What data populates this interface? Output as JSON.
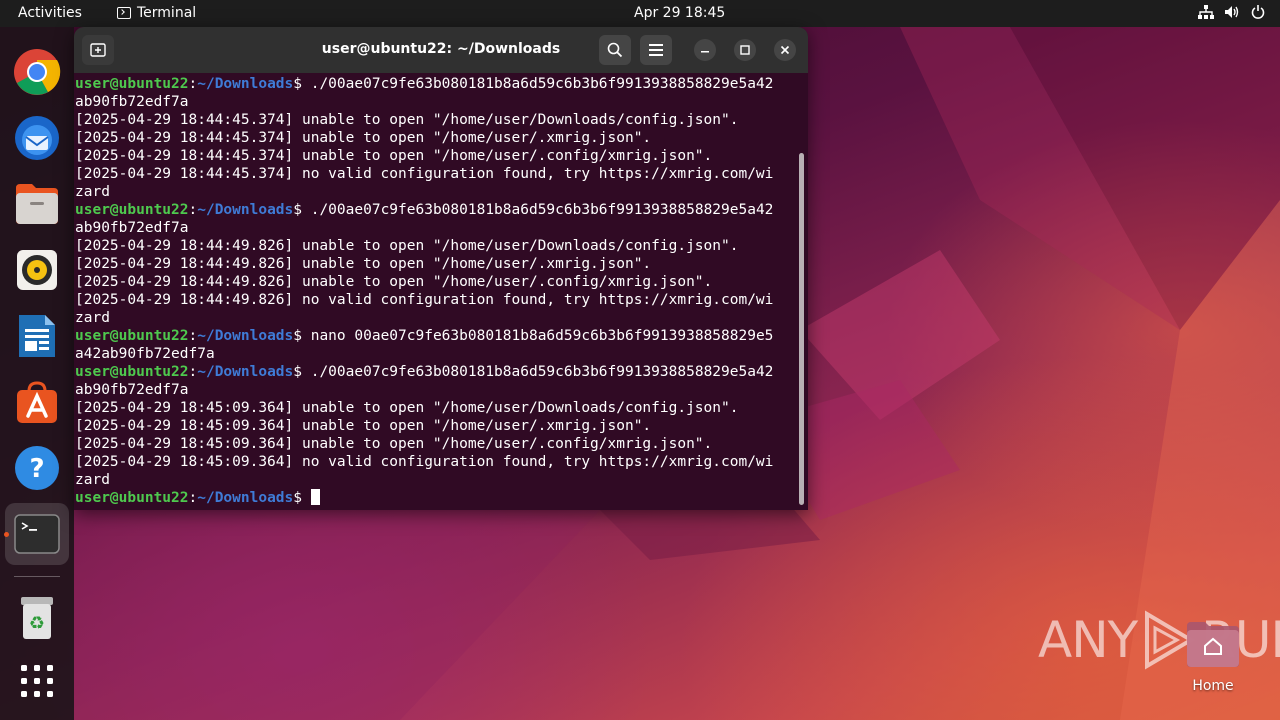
{
  "topbar": {
    "activities": "Activities",
    "app_name": "Terminal",
    "clock": "Apr 29  18:45",
    "icons": [
      "network-icon",
      "volume-icon",
      "power-icon"
    ]
  },
  "dock": {
    "items": [
      {
        "name": "Google Chrome",
        "icon": "chrome-icon"
      },
      {
        "name": "Thunderbird Mail",
        "icon": "thunderbird-icon"
      },
      {
        "name": "Files",
        "icon": "files-icon"
      },
      {
        "name": "Rhythmbox",
        "icon": "rhythmbox-icon"
      },
      {
        "name": "LibreOffice Writer",
        "icon": "writer-icon"
      },
      {
        "name": "Ubuntu Software",
        "icon": "software-icon"
      },
      {
        "name": "Help",
        "icon": "help-icon"
      },
      {
        "name": "Terminal",
        "icon": "terminal-icon",
        "active": true
      },
      {
        "name": "Trash",
        "icon": "trash-icon"
      },
      {
        "name": "Show Applications",
        "icon": "app-grid-icon"
      }
    ],
    "accent_color": "#e95420"
  },
  "terminal": {
    "title": "user@ubuntu22: ~/Downloads",
    "prompt": {
      "user": "user@ubuntu22",
      "colon": ":",
      "path": "~/Downloads",
      "symbol": "$ "
    },
    "colors": {
      "background": "#300a24",
      "user": "#4ec94e",
      "path": "#3f7bd6",
      "text": "#ffffff"
    },
    "lines": [
      {
        "type": "prompt",
        "cmd": "./00ae07c9fe63b080181b8a6d59c6b3b6f9913938858829e5a42"
      },
      {
        "type": "out",
        "text": "ab90fb72edf7a"
      },
      {
        "type": "out",
        "text": "[2025-04-29 18:44:45.374] unable to open \"/home/user/Downloads/config.json\"."
      },
      {
        "type": "out",
        "text": "[2025-04-29 18:44:45.374] unable to open \"/home/user/.xmrig.json\"."
      },
      {
        "type": "out",
        "text": "[2025-04-29 18:44:45.374] unable to open \"/home/user/.config/xmrig.json\"."
      },
      {
        "type": "out",
        "text": "[2025-04-29 18:44:45.374] no valid configuration found, try https://xmrig.com/wi"
      },
      {
        "type": "out",
        "text": "zard"
      },
      {
        "type": "prompt",
        "cmd": "./00ae07c9fe63b080181b8a6d59c6b3b6f9913938858829e5a42"
      },
      {
        "type": "out",
        "text": "ab90fb72edf7a"
      },
      {
        "type": "out",
        "text": "[2025-04-29 18:44:49.826] unable to open \"/home/user/Downloads/config.json\"."
      },
      {
        "type": "out",
        "text": "[2025-04-29 18:44:49.826] unable to open \"/home/user/.xmrig.json\"."
      },
      {
        "type": "out",
        "text": "[2025-04-29 18:44:49.826] unable to open \"/home/user/.config/xmrig.json\"."
      },
      {
        "type": "out",
        "text": "[2025-04-29 18:44:49.826] no valid configuration found, try https://xmrig.com/wi"
      },
      {
        "type": "out",
        "text": "zard"
      },
      {
        "type": "prompt",
        "cmd": "nano 00ae07c9fe63b080181b8a6d59c6b3b6f9913938858829e5"
      },
      {
        "type": "out",
        "text": "a42ab90fb72edf7a"
      },
      {
        "type": "prompt",
        "cmd": "./00ae07c9fe63b080181b8a6d59c6b3b6f9913938858829e5a42"
      },
      {
        "type": "out",
        "text": "ab90fb72edf7a"
      },
      {
        "type": "out",
        "text": "[2025-04-29 18:45:09.364] unable to open \"/home/user/Downloads/config.json\"."
      },
      {
        "type": "out",
        "text": "[2025-04-29 18:45:09.364] unable to open \"/home/user/.xmrig.json\"."
      },
      {
        "type": "out",
        "text": "[2025-04-29 18:45:09.364] unable to open \"/home/user/.config/xmrig.json\"."
      },
      {
        "type": "out",
        "text": "[2025-04-29 18:45:09.364] no valid configuration found, try https://xmrig.com/wi"
      },
      {
        "type": "out",
        "text": "zard"
      },
      {
        "type": "prompt",
        "cmd": "",
        "cursor": true
      }
    ]
  },
  "desktop": {
    "home_label": "Home",
    "watermark": "ANY RUN"
  }
}
